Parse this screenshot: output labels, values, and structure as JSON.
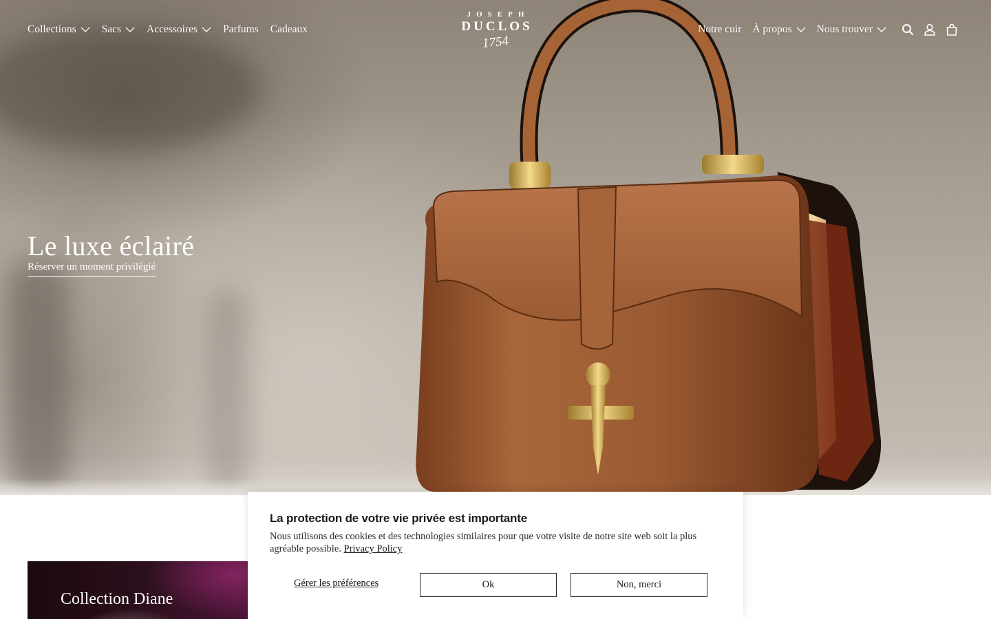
{
  "nav": {
    "left": [
      {
        "label": "Collections",
        "has_dropdown": true
      },
      {
        "label": "Sacs",
        "has_dropdown": true
      },
      {
        "label": "Accessoires",
        "has_dropdown": true
      },
      {
        "label": "Parfums",
        "has_dropdown": false
      },
      {
        "label": "Cadeaux",
        "has_dropdown": false
      }
    ],
    "right": [
      {
        "label": "Notre cuir",
        "has_dropdown": false
      },
      {
        "label": "À propos",
        "has_dropdown": true
      },
      {
        "label": "Nous trouver",
        "has_dropdown": true
      }
    ],
    "icons": [
      "search-icon",
      "user-icon",
      "shopping-bag-icon"
    ]
  },
  "logo": {
    "top": "JOSEPH",
    "name": "DUCLOS",
    "year": "1754"
  },
  "hero": {
    "title": "Le luxe éclairé",
    "cta": "Réserver un moment privilégié"
  },
  "collection": {
    "title": "Collection Diane"
  },
  "cookie": {
    "title": "La protection de votre vie privée est importante",
    "text": "Nous utilisons des cookies et des technologies similaires pour que votre visite de notre site web soit la plus agréable possible.",
    "link": "Privacy Policy",
    "manage": "Gérer les préférences",
    "ok": "Ok",
    "no": "Non, merci"
  },
  "colors": {
    "leather": "#9a5a32",
    "gold": "#c9a24a",
    "text_dark": "#1a1a1a"
  }
}
